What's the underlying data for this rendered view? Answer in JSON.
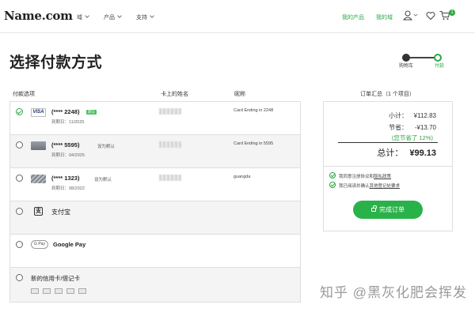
{
  "header": {
    "logo": "Name.com",
    "nav": [
      "域",
      "产品",
      "支持"
    ],
    "links": [
      "我的产品",
      "我的域"
    ],
    "cart_count": "1",
    "icons": [
      "user-icon",
      "heart-icon",
      "cart-icon"
    ]
  },
  "title": "选择付款方式",
  "progress": {
    "step1": "购物车",
    "step2": "付款"
  },
  "columns": {
    "options": "付款选项",
    "name": "卡上的姓名",
    "nickname": "昵称"
  },
  "payments": [
    {
      "brand": "VISA",
      "number": "(**** 2248)",
      "tag": "默认",
      "expiry": "到期日：11/2025",
      "nickname": "Card Ending in 2248",
      "selected": true
    },
    {
      "number": "(**** 5595)",
      "default_link": "设为默认",
      "expiry": "到期日：04/2025",
      "nickname": "Card Ending in 5595"
    },
    {
      "number": "(**** 1323)",
      "default_link": "设为默认",
      "expiry": "到期日：08/2022",
      "nickname": "guangda"
    },
    {
      "label": "支付宝",
      "logo": "支"
    },
    {
      "label": "Google Pay",
      "logo": "G Pay"
    },
    {
      "label": "新的信用卡/借记卡"
    }
  ],
  "summary": {
    "title": "订单汇总（1 个项目）",
    "subtotal_label": "小计：",
    "subtotal": "¥112.83",
    "savings_label": "节省：",
    "savings": "-¥13.70",
    "savings_pct": "(您节省了 12%)",
    "total_label": "总计：",
    "total": "¥99.13",
    "agree1_prefix": "我同意注册协议和",
    "agree1_link": "隐私政策",
    "agree2_prefix": "我已阅读并确认",
    "agree2_link": "其他登记处要求",
    "button": "完成订单"
  },
  "watermark": "知乎 @黑灰化肥会挥发",
  "colors": {
    "accent": "#2aa844",
    "button": "#2ab24a"
  }
}
